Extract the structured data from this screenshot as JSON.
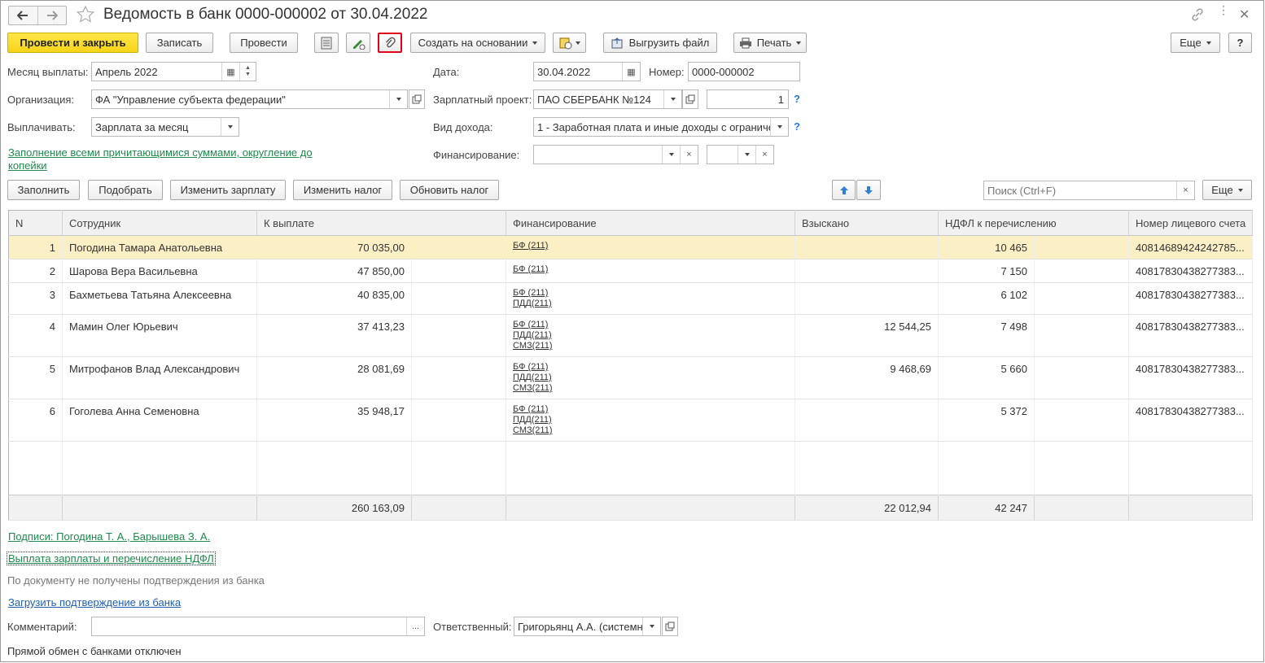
{
  "window": {
    "title": "Ведомость в банк 0000-000002 от 30.04.2022"
  },
  "toolbar": {
    "post_and_close": "Провести и закрыть",
    "write": "Записать",
    "post": "Провести",
    "create_based_on": "Создать на основании",
    "upload_file": "Выгрузить файл",
    "print": "Печать",
    "more": "Еще",
    "help": "?"
  },
  "form": {
    "pay_month_label": "Месяц выплаты:",
    "pay_month_value": "Апрель 2022",
    "date_label": "Дата:",
    "date_value": "30.04.2022",
    "number_label": "Номер:",
    "number_value": "0000-000002",
    "org_label": "Организация:",
    "org_value": "ФА \"Управление субъекта федерации\"",
    "salary_project_label": "Зарплатный проект:",
    "salary_project_value": "ПАО СБЕРБАНК №124",
    "salary_project_num": "1",
    "pay_label": "Выплачивать:",
    "pay_value": "Зарплата за месяц",
    "income_type_label": "Вид дохода:",
    "income_type_value": "1 - Заработная плата и иные доходы с ограниче",
    "fill_link_line1": "Заполнение всеми причитающимися суммами, округление до",
    "fill_link_line2": "копейки",
    "financing_label": "Финансирование:"
  },
  "table_toolbar": {
    "fill": "Заполнить",
    "select": "Подобрать",
    "change_salary": "Изменить зарплату",
    "change_tax": "Изменить налог",
    "update_tax": "Обновить налог",
    "search_placeholder": "Поиск (Ctrl+F)",
    "more": "Еще"
  },
  "table": {
    "headers": [
      "N",
      "Сотрудник",
      "К выплате",
      "Финансирование",
      "Взыскано",
      "НДФЛ к перечислению",
      "Номер лицевого счета"
    ],
    "rows": [
      {
        "n": "1",
        "employee": "Погодина Тамара Анатольевна",
        "amount": "70 035,00",
        "fin": [
          "БФ (211)"
        ],
        "withheld": "",
        "ndfl": "10 465",
        "account": "40814689424242785..."
      },
      {
        "n": "2",
        "employee": "Шарова Вера Васильевна",
        "amount": "47 850,00",
        "fin": [
          "БФ (211)"
        ],
        "withheld": "",
        "ndfl": "7 150",
        "account": "40817830438277383..."
      },
      {
        "n": "3",
        "employee": "Бахметьева Татьяна Алексеевна",
        "amount": "40 835,00",
        "fin": [
          "БФ (211)",
          "ПДД(211)"
        ],
        "withheld": "",
        "ndfl": "6 102",
        "account": "40817830438277383..."
      },
      {
        "n": "4",
        "employee": "Мамин Олег Юрьевич",
        "amount": "37 413,23",
        "fin": [
          "БФ (211)",
          "ПДД(211)",
          "СМЗ(211)"
        ],
        "withheld": "12 544,25",
        "ndfl": "7 498",
        "account": "40817830438277383..."
      },
      {
        "n": "5",
        "employee": "Митрофанов Влад Александрович",
        "amount": "28 081,69",
        "fin": [
          "БФ (211)",
          "ПДД(211)",
          "СМЗ(211)"
        ],
        "withheld": "9 468,69",
        "ndfl": "5 660",
        "account": "40817830438277383..."
      },
      {
        "n": "6",
        "employee": "Гоголева Анна Семеновна",
        "amount": "35 948,17",
        "fin": [
          "БФ (211)",
          "ПДД(211)",
          "СМЗ(211)"
        ],
        "withheld": "",
        "ndfl": "5 372",
        "account": "40817830438277383..."
      }
    ],
    "totals": {
      "amount": "260 163,09",
      "withheld": "22 012,94",
      "ndfl": "42 247"
    }
  },
  "footer": {
    "signatures_link": "Подписи: Погодина Т. А., Барышева З. А.",
    "payment_link": "Выплата зарплаты и перечисление НДФЛ",
    "bank_status": "По документу не получены подтверждения из банка",
    "load_confirmation_link": "Загрузить подтверждение из банка",
    "comment_label": "Комментарий:",
    "comment_value": "",
    "responsible_label": "Ответственный:",
    "responsible_value": "Григорьянц А.А. (системн",
    "exchange_status": "Прямой обмен с банками отключен"
  },
  "colors": {
    "primary_button": "#f7d419",
    "link_green": "#1e8a4c",
    "link_blue": "#1f5fb0",
    "selected_row": "#fbefc6",
    "highlight_border": "#e0001b"
  }
}
